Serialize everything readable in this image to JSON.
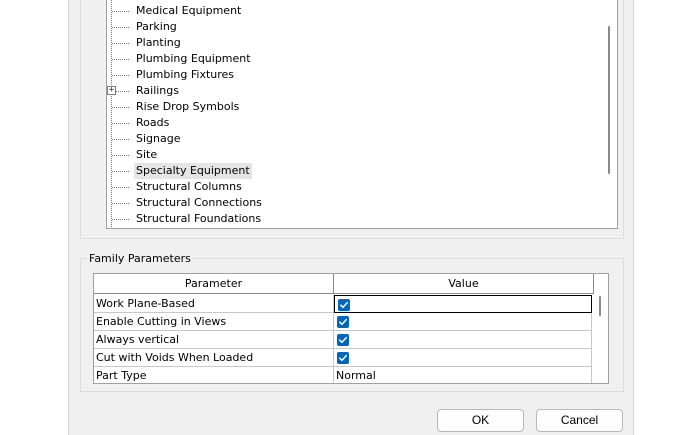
{
  "tree": {
    "items": [
      {
        "label": "Medical Equipment",
        "expandable": false,
        "selected": false
      },
      {
        "label": "Parking",
        "expandable": false,
        "selected": false
      },
      {
        "label": "Planting",
        "expandable": false,
        "selected": false
      },
      {
        "label": "Plumbing Equipment",
        "expandable": false,
        "selected": false
      },
      {
        "label": "Plumbing Fixtures",
        "expandable": false,
        "selected": false
      },
      {
        "label": "Railings",
        "expandable": true,
        "selected": false
      },
      {
        "label": "Rise Drop Symbols",
        "expandable": false,
        "selected": false
      },
      {
        "label": "Roads",
        "expandable": false,
        "selected": false
      },
      {
        "label": "Signage",
        "expandable": false,
        "selected": false
      },
      {
        "label": "Site",
        "expandable": false,
        "selected": false
      },
      {
        "label": "Specialty Equipment",
        "expandable": false,
        "selected": true
      },
      {
        "label": "Structural Columns",
        "expandable": false,
        "selected": false
      },
      {
        "label": "Structural Connections",
        "expandable": false,
        "selected": false
      },
      {
        "label": "Structural Foundations",
        "expandable": false,
        "selected": false
      }
    ],
    "expander_glyph": "+"
  },
  "family_parameters": {
    "title": "Family Parameters",
    "columns": {
      "parameter": "Parameter",
      "value": "Value"
    },
    "rows": [
      {
        "parameter": "Work Plane-Based",
        "value_type": "checkbox",
        "checked": true,
        "text": ""
      },
      {
        "parameter": "Enable Cutting in Views",
        "value_type": "checkbox",
        "checked": true,
        "text": ""
      },
      {
        "parameter": "Always vertical",
        "value_type": "checkbox",
        "checked": true,
        "text": ""
      },
      {
        "parameter": "Cut with Voids When Loaded",
        "value_type": "checkbox",
        "checked": true,
        "text": ""
      },
      {
        "parameter": "Part Type",
        "value_type": "text",
        "checked": false,
        "text": "Normal"
      }
    ],
    "checkbox_color": "#0067c0"
  },
  "buttons": {
    "ok": "OK",
    "cancel": "Cancel"
  }
}
